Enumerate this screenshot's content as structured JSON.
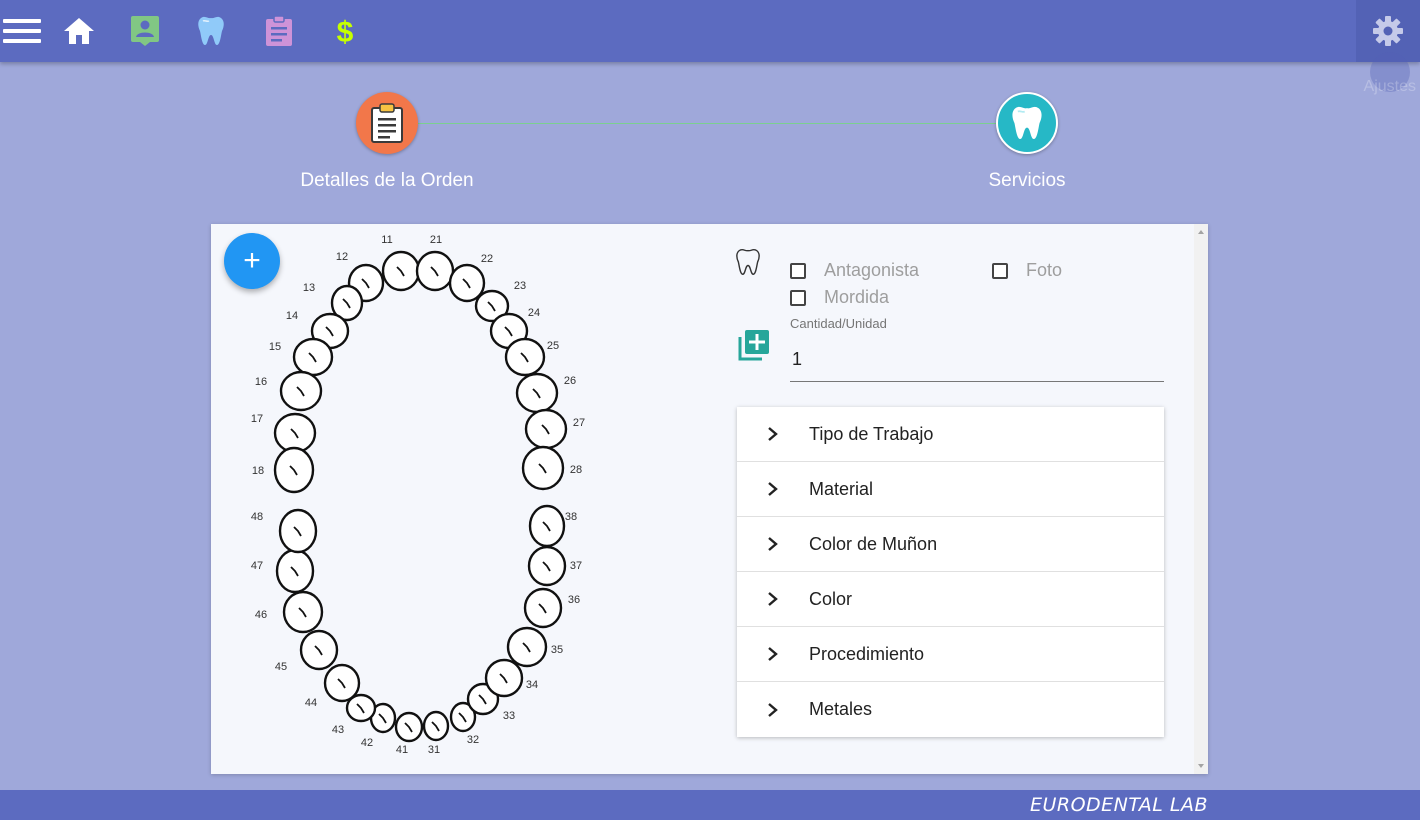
{
  "toolbar": {
    "icons": [
      "menu-icon",
      "home-icon",
      "patient-icon",
      "tooth-icon",
      "order-icon",
      "dollar-icon",
      "gear-icon"
    ],
    "settings_label": "Ajustes",
    "colors": {
      "bar": "#5c6bc0",
      "patient": "#81c784",
      "tooth": "#90caf9",
      "order": "#ce93d8",
      "dollar": "#c6ff00"
    }
  },
  "stepper": {
    "steps": [
      {
        "label": "Detalles de la Orden",
        "icon": "clipboard-icon",
        "color": "#f2774a"
      },
      {
        "label": "Servicios",
        "icon": "tooth-icon",
        "color": "#26b8c6"
      }
    ]
  },
  "card": {
    "fab_label": "+",
    "tooth_chart": {
      "upper_right": [
        "11",
        "12",
        "13",
        "14",
        "15",
        "16",
        "17",
        "18"
      ],
      "upper_left": [
        "21",
        "22",
        "23",
        "24",
        "25",
        "26",
        "27",
        "28"
      ],
      "lower_left": [
        "31",
        "32",
        "33",
        "34",
        "35",
        "36",
        "37",
        "38"
      ],
      "lower_right": [
        "41",
        "42",
        "43",
        "44",
        "45",
        "46",
        "47",
        "48"
      ]
    },
    "checkboxes": {
      "antagonista": {
        "label": "Antagonista",
        "checked": false
      },
      "foto": {
        "label": "Foto",
        "checked": false
      },
      "mordida": {
        "label": "Mordida",
        "checked": false
      }
    },
    "quantity": {
      "label": "Cantidad/Unidad",
      "value": "1"
    },
    "accordion": [
      "Tipo de Trabajo",
      "Material",
      "Color de Muñon",
      "Color",
      "Procedimiento",
      "Metales"
    ]
  },
  "footer": {
    "brand": "EURODENTAL LAB"
  }
}
